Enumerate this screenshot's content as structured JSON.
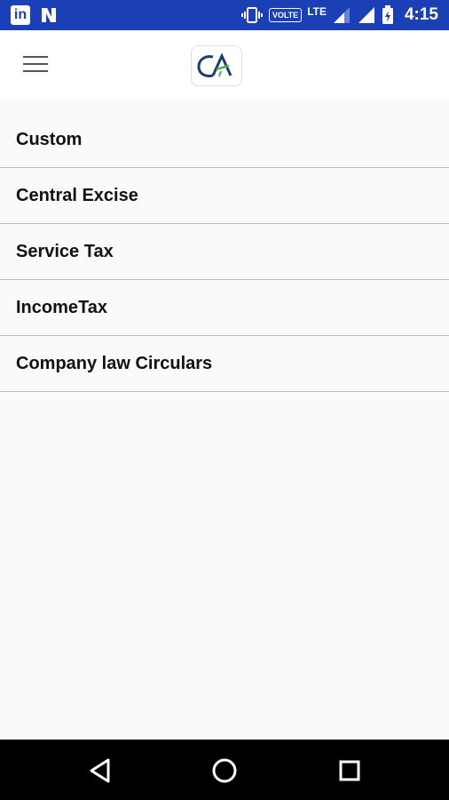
{
  "status_bar": {
    "left_icons": [
      "linkedin-icon",
      "n-notification-icon"
    ],
    "linkedin_letters": "in",
    "volte_label": "VOLTE",
    "network_label": "LTE",
    "time": "4:15"
  },
  "app_bar": {
    "menu_icon": "hamburger-icon",
    "logo_text": "CA"
  },
  "menu": {
    "items": [
      {
        "label": "Custom"
      },
      {
        "label": "Central Excise"
      },
      {
        "label": "Service Tax"
      },
      {
        "label": "IncomeTax"
      },
      {
        "label": "Company law Circulars"
      }
    ]
  },
  "nav_bar": {
    "buttons": [
      "back-icon",
      "home-icon",
      "recents-icon"
    ]
  },
  "colors": {
    "status_bar": "#1b3fb5",
    "background": "#fafafa",
    "divider": "#bdbdbd",
    "logo_blue": "#1f3b73",
    "logo_green": "#4caf50"
  }
}
